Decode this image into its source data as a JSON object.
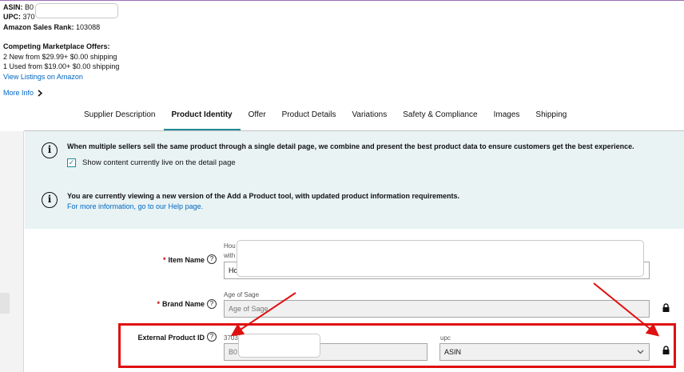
{
  "product": {
    "asin_label": "ASIN:",
    "asin_value": "B0",
    "upc_label": "UPC:",
    "upc_value": "370",
    "rank_label": "Amazon Sales Rank:",
    "rank_value": "103088"
  },
  "offers": {
    "title": "Competing Marketplace Offers:",
    "new_line": "2 New  from $29.99+ $0.00 shipping",
    "used_line": "1 Used  from $19.00+ $0.00 shipping",
    "view_link": "View Listings on Amazon"
  },
  "more_info": "More Info",
  "tabs": [
    {
      "label": "Supplier Description",
      "active": false
    },
    {
      "label": "Product Identity",
      "active": true
    },
    {
      "label": "Offer",
      "active": false
    },
    {
      "label": "Product Details",
      "active": false
    },
    {
      "label": "Variations",
      "active": false
    },
    {
      "label": "Safety & Compliance",
      "active": false
    },
    {
      "label": "Images",
      "active": false
    },
    {
      "label": "Shipping",
      "active": false
    }
  ],
  "banner": {
    "message1": "When multiple sellers sell the same product through a single detail page, we combine and present the best product data to ensure customers get the best experience.",
    "checkbox_label": "Show content currently live on the detail page",
    "checkbox_checked": true,
    "message2": "You are currently viewing a new version of the Add a Product tool, with updated product information requirements.",
    "help_link": "For more information, go to our Help page."
  },
  "form": {
    "item_name": {
      "label": "Item Name",
      "hint_line1": "Hou",
      "hint_line2": "with",
      "value": "Ho"
    },
    "brand_name": {
      "label": "Brand Name",
      "hint": "Age of Sage",
      "value": "Age of Sage"
    },
    "external_id": {
      "label": "External Product ID",
      "hint": "3703",
      "value": "B0",
      "type_hint": "upc",
      "type_value": "ASIN"
    }
  },
  "colors": {
    "accent": "#238a95",
    "link": "#0066c0",
    "annotation_red": "#e01010",
    "banner_bg": "#e9f3f4"
  }
}
